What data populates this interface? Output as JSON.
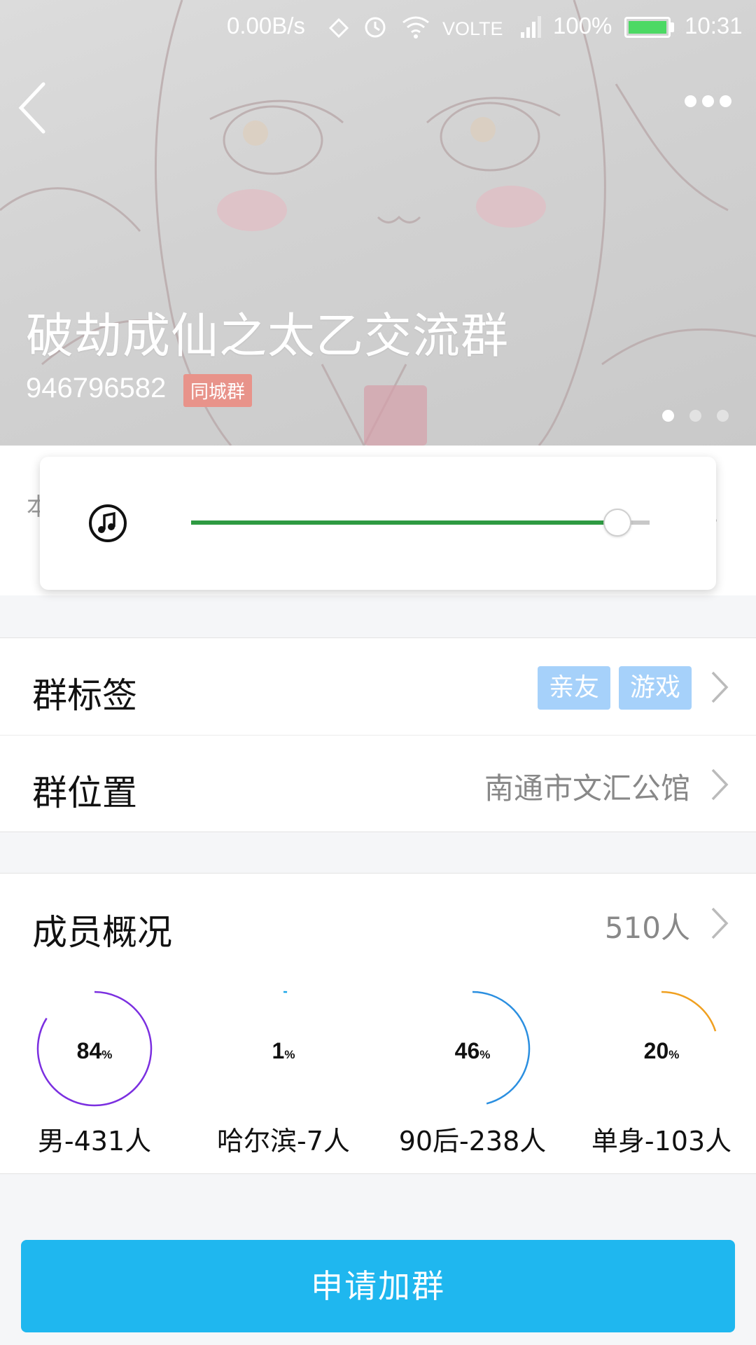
{
  "status_bar": {
    "net_speed": "0.00B/s",
    "volte": "VOLTE",
    "battery": "100%",
    "time": "10:31"
  },
  "header": {
    "group_name": "破劫成仙之太乙交流群",
    "group_id": "946796582",
    "badge": "同城群",
    "carousel_pages": 3,
    "carousel_active": 0
  },
  "intro": {
    "hint_start": "本",
    "hint_end": "。"
  },
  "player": {
    "icon": "music-note-icon",
    "progress": 0.93,
    "fill_color": "#2e9a42"
  },
  "tags_row": {
    "label": "群标签",
    "tags": [
      "亲友",
      "游戏"
    ]
  },
  "location_row": {
    "label": "群位置",
    "value": "南通市文汇公馆"
  },
  "members_row": {
    "label": "成员概况",
    "value": "510人"
  },
  "stats": [
    {
      "percent": "84",
      "unit": "%",
      "label": "男-431人",
      "color": "#7b2fe0",
      "value": 84
    },
    {
      "percent": "1",
      "unit": "%",
      "label": "哈尔滨-7人",
      "color": "#1ea7e8",
      "value": 1
    },
    {
      "percent": "46",
      "unit": "%",
      "label": "90后-238人",
      "color": "#2b8fe0",
      "value": 46
    },
    {
      "percent": "20",
      "unit": "%",
      "label": "单身-103人",
      "color": "#f0a020",
      "value": 20
    }
  ],
  "join_button": {
    "label": "申请加群",
    "color": "#1fb7ef"
  }
}
